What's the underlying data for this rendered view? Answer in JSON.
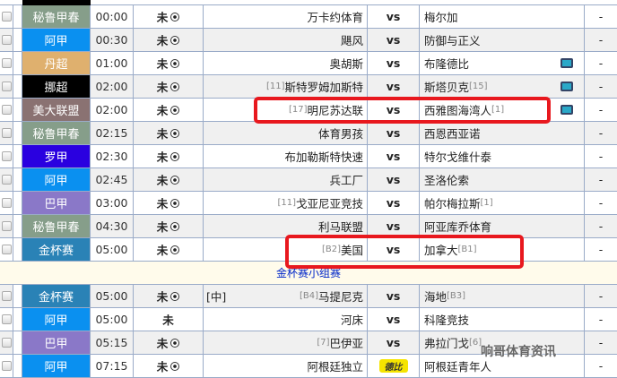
{
  "vs_label": "vs",
  "colors": {
    "秘鲁甲春": "#869e8a",
    "阿甲": "#0a90f0",
    "丹超": "#dfb06e",
    "挪超": "#000000",
    "美大联盟": "#8a7272",
    "罗甲": "#2a00e0",
    "巴甲": "#8a78c8",
    "金杯赛": "#2a82b6"
  },
  "rows": [
    {
      "league": "秘鲁甲春",
      "time": "00:00",
      "status": "未",
      "home": "万卡约体育",
      "home_rank": "",
      "away": "梅尔加",
      "away_rank": "",
      "tv": false,
      "ball": true,
      "result": "-"
    },
    {
      "league": "阿甲",
      "time": "00:30",
      "status": "未",
      "home": "飓风",
      "home_rank": "",
      "away": "防御与正义",
      "away_rank": "",
      "tv": false,
      "ball": true,
      "result": "-"
    },
    {
      "league": "丹超",
      "time": "01:00",
      "status": "未",
      "home": "奥胡斯",
      "home_rank": "",
      "away": "布隆德比",
      "away_rank": "",
      "tv": true,
      "ball": true,
      "result": "-"
    },
    {
      "league": "挪超",
      "time": "02:00",
      "status": "未",
      "home": "斯特罗姆加斯特",
      "home_rank": "[11]",
      "away": "斯塔贝克",
      "away_rank": "[15]",
      "tv": true,
      "ball": true,
      "result": "-"
    },
    {
      "league": "美大联盟",
      "time": "02:00",
      "status": "未",
      "home": "明尼苏达联",
      "home_rank": "[17]",
      "away": "西雅图海湾人",
      "away_rank": "[1]",
      "tv": true,
      "ball": true,
      "result": "-"
    },
    {
      "league": "秘鲁甲春",
      "time": "02:15",
      "status": "未",
      "home": "体育男孩",
      "home_rank": "",
      "away": "西恩西亚诺",
      "away_rank": "",
      "tv": false,
      "ball": true,
      "result": "-"
    },
    {
      "league": "罗甲",
      "time": "02:30",
      "status": "未",
      "home": "布加勒斯特快速",
      "home_rank": "",
      "away": "特尔戈维什泰",
      "away_rank": "",
      "tv": false,
      "ball": true,
      "result": "-"
    },
    {
      "league": "阿甲",
      "time": "02:45",
      "status": "未",
      "home": "兵工厂",
      "home_rank": "",
      "away": "圣洛伦索",
      "away_rank": "",
      "tv": false,
      "ball": true,
      "result": "-"
    },
    {
      "league": "巴甲",
      "time": "03:00",
      "status": "未",
      "home": "戈亚尼亚竞技",
      "home_rank": "[11]",
      "away": "帕尔梅拉斯",
      "away_rank": "[1]",
      "tv": false,
      "ball": true,
      "result": "-"
    },
    {
      "league": "秘鲁甲春",
      "time": "04:30",
      "status": "未",
      "home": "利马联盟",
      "home_rank": "",
      "away": "阿亚库乔体育",
      "away_rank": "",
      "tv": false,
      "ball": true,
      "result": "-"
    },
    {
      "league": "金杯赛",
      "time": "05:00",
      "status": "未",
      "home": "美国",
      "home_rank": "[B2]",
      "away": "加拿大",
      "away_rank": "[B1]",
      "tv": false,
      "ball": true,
      "result": "-"
    }
  ],
  "separator": "金杯赛小组赛",
  "rows2": [
    {
      "league": "金杯赛",
      "time": "05:00",
      "status": "未",
      "neutral": "[中]",
      "home": "马提尼克",
      "home_rank": "[B4]",
      "away": "海地",
      "away_rank": "[B3]",
      "ball": true,
      "result": "-"
    },
    {
      "league": "阿甲",
      "time": "05:00",
      "status": "未",
      "neutral": "",
      "home": "河床",
      "home_rank": "",
      "away": "科隆竞技",
      "away_rank": "",
      "ball": false,
      "result": "-"
    },
    {
      "league": "巴甲",
      "time": "05:15",
      "status": "未",
      "neutral": "",
      "home": "巴伊亚",
      "home_rank": "[7]",
      "away": "弗拉门戈",
      "away_rank": "[6]",
      "ball": true,
      "result": "-"
    },
    {
      "league": "阿甲",
      "time": "07:15",
      "status": "未",
      "neutral": "",
      "home": "阿根廷独立",
      "home_rank": "",
      "away": "阿根廷青年人",
      "away_rank": "",
      "ball": true,
      "result": "-",
      "badge": "德比"
    }
  ],
  "watermark": "响哥体育资讯"
}
